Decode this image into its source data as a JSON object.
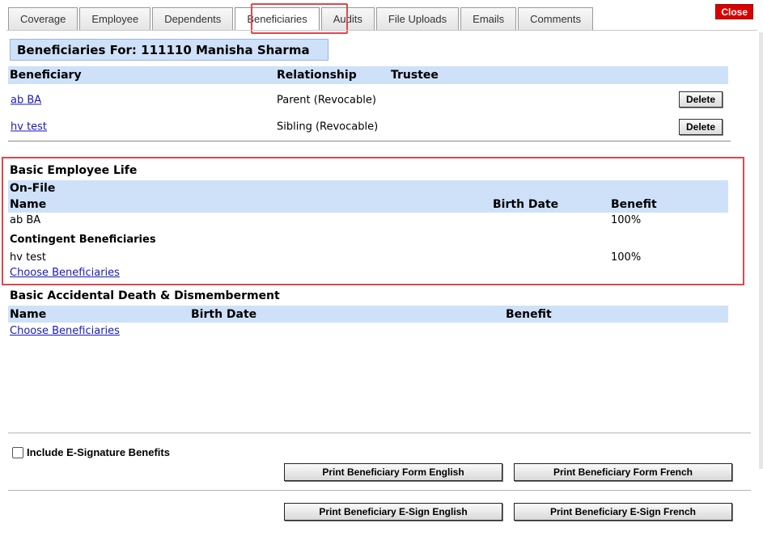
{
  "tabs": [
    "Coverage",
    "Employee",
    "Dependents",
    "Beneficiaries",
    "Audits",
    "File Uploads",
    "Emails",
    "Comments"
  ],
  "active_tab": "Beneficiaries",
  "close_label": "Close",
  "title": "Beneficiaries For: 111110 Manisha Sharma",
  "beneficiary_table": {
    "headers": {
      "beneficiary": "Beneficiary",
      "relationship": "Relationship",
      "trustee": "Trustee"
    },
    "rows": [
      {
        "name": "ab BA",
        "relationship": "Parent (Revocable)",
        "delete_label": "Delete"
      },
      {
        "name": "hv test",
        "relationship": "Sibling (Revocable)",
        "delete_label": "Delete"
      }
    ]
  },
  "basic_life": {
    "title": "Basic Employee Life",
    "on_file": "On-File",
    "headers": {
      "name": "Name",
      "birth_date": "Birth Date",
      "benefit": "Benefit"
    },
    "primary": {
      "name": "ab BA",
      "benefit": "100%"
    },
    "contingent_title": "Contingent Beneficiaries",
    "contingent": {
      "name": "hv test",
      "benefit": "100%"
    },
    "choose_link": "Choose Beneficiaries"
  },
  "add": {
    "title": "Basic Accidental Death & Dismemberment",
    "headers": {
      "name": "Name",
      "birth_date": "Birth Date",
      "benefit": "Benefit"
    },
    "choose_link": "Choose Beneficiaries"
  },
  "esign_checkbox_label": "Include E-Signature Benefits",
  "print_buttons": {
    "form_english": "Print Beneficiary Form English",
    "form_french": "Print Beneficiary Form French",
    "esign_english": "Print Beneficiary E-Sign English",
    "esign_french": "Print Beneficiary E-Sign French"
  },
  "colors": {
    "header_blue": "#cfe1f9",
    "highlight_red": "#e0474c",
    "close_red": "#d90000",
    "link_blue": "#1a1ab8"
  }
}
